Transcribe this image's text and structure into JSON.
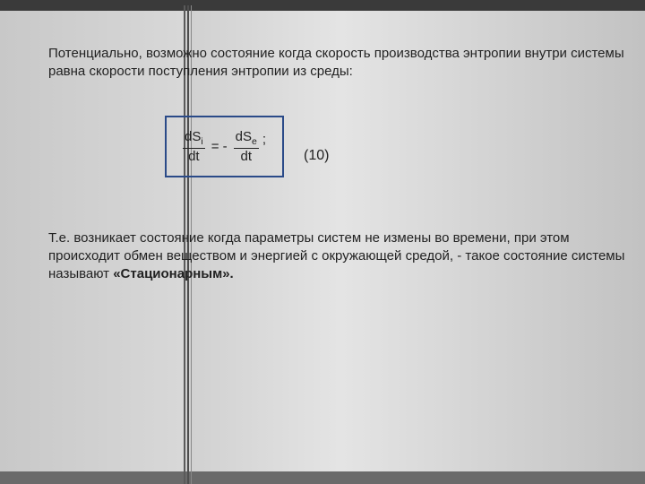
{
  "corner_label": "",
  "para1": "Потенциально, возможно состояние когда скорость производства энтропии внутри системы равна скорости поступления энтропии из среды:",
  "equation": {
    "lhs_num_base": "dS",
    "lhs_num_sub": "i",
    "lhs_den": "dt",
    "sign": "= -",
    "rhs_num_base": "dS",
    "rhs_num_sub": "e",
    "rhs_den": "dt",
    "after": ";",
    "number": "(10)"
  },
  "para2_a": "Т.е. возникает состояние когда параметры систем не измены во времени, при этом происходит обмен веществом и энергией с окружающей средой, - такое состояние системы называют ",
  "para2_b": "«Стационарным»."
}
